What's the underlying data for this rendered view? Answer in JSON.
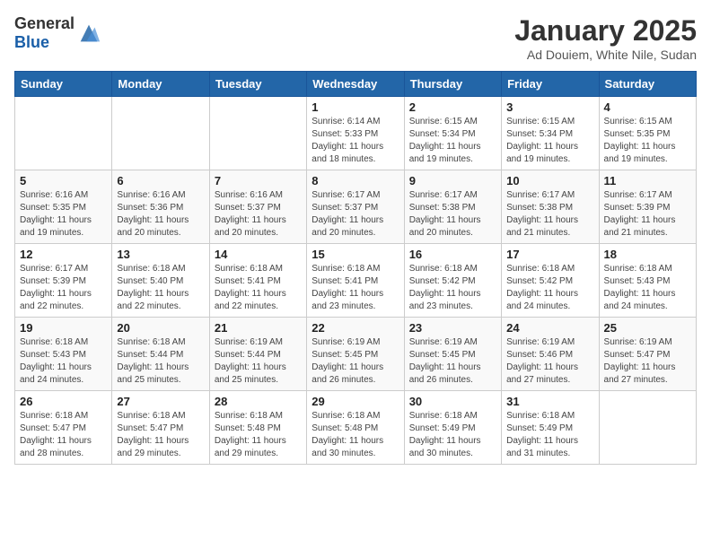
{
  "header": {
    "logo_general": "General",
    "logo_blue": "Blue",
    "month": "January 2025",
    "location": "Ad Douiem, White Nile, Sudan"
  },
  "weekdays": [
    "Sunday",
    "Monday",
    "Tuesday",
    "Wednesday",
    "Thursday",
    "Friday",
    "Saturday"
  ],
  "weeks": [
    [
      {
        "day": "",
        "sunrise": "",
        "sunset": "",
        "daylight": ""
      },
      {
        "day": "",
        "sunrise": "",
        "sunset": "",
        "daylight": ""
      },
      {
        "day": "",
        "sunrise": "",
        "sunset": "",
        "daylight": ""
      },
      {
        "day": "1",
        "sunrise": "6:14 AM",
        "sunset": "5:33 PM",
        "daylight": "11 hours and 18 minutes."
      },
      {
        "day": "2",
        "sunrise": "6:15 AM",
        "sunset": "5:34 PM",
        "daylight": "11 hours and 19 minutes."
      },
      {
        "day": "3",
        "sunrise": "6:15 AM",
        "sunset": "5:34 PM",
        "daylight": "11 hours and 19 minutes."
      },
      {
        "day": "4",
        "sunrise": "6:15 AM",
        "sunset": "5:35 PM",
        "daylight": "11 hours and 19 minutes."
      }
    ],
    [
      {
        "day": "5",
        "sunrise": "6:16 AM",
        "sunset": "5:35 PM",
        "daylight": "11 hours and 19 minutes."
      },
      {
        "day": "6",
        "sunrise": "6:16 AM",
        "sunset": "5:36 PM",
        "daylight": "11 hours and 20 minutes."
      },
      {
        "day": "7",
        "sunrise": "6:16 AM",
        "sunset": "5:37 PM",
        "daylight": "11 hours and 20 minutes."
      },
      {
        "day": "8",
        "sunrise": "6:17 AM",
        "sunset": "5:37 PM",
        "daylight": "11 hours and 20 minutes."
      },
      {
        "day": "9",
        "sunrise": "6:17 AM",
        "sunset": "5:38 PM",
        "daylight": "11 hours and 20 minutes."
      },
      {
        "day": "10",
        "sunrise": "6:17 AM",
        "sunset": "5:38 PM",
        "daylight": "11 hours and 21 minutes."
      },
      {
        "day": "11",
        "sunrise": "6:17 AM",
        "sunset": "5:39 PM",
        "daylight": "11 hours and 21 minutes."
      }
    ],
    [
      {
        "day": "12",
        "sunrise": "6:17 AM",
        "sunset": "5:39 PM",
        "daylight": "11 hours and 22 minutes."
      },
      {
        "day": "13",
        "sunrise": "6:18 AM",
        "sunset": "5:40 PM",
        "daylight": "11 hours and 22 minutes."
      },
      {
        "day": "14",
        "sunrise": "6:18 AM",
        "sunset": "5:41 PM",
        "daylight": "11 hours and 22 minutes."
      },
      {
        "day": "15",
        "sunrise": "6:18 AM",
        "sunset": "5:41 PM",
        "daylight": "11 hours and 23 minutes."
      },
      {
        "day": "16",
        "sunrise": "6:18 AM",
        "sunset": "5:42 PM",
        "daylight": "11 hours and 23 minutes."
      },
      {
        "day": "17",
        "sunrise": "6:18 AM",
        "sunset": "5:42 PM",
        "daylight": "11 hours and 24 minutes."
      },
      {
        "day": "18",
        "sunrise": "6:18 AM",
        "sunset": "5:43 PM",
        "daylight": "11 hours and 24 minutes."
      }
    ],
    [
      {
        "day": "19",
        "sunrise": "6:18 AM",
        "sunset": "5:43 PM",
        "daylight": "11 hours and 24 minutes."
      },
      {
        "day": "20",
        "sunrise": "6:18 AM",
        "sunset": "5:44 PM",
        "daylight": "11 hours and 25 minutes."
      },
      {
        "day": "21",
        "sunrise": "6:19 AM",
        "sunset": "5:44 PM",
        "daylight": "11 hours and 25 minutes."
      },
      {
        "day": "22",
        "sunrise": "6:19 AM",
        "sunset": "5:45 PM",
        "daylight": "11 hours and 26 minutes."
      },
      {
        "day": "23",
        "sunrise": "6:19 AM",
        "sunset": "5:45 PM",
        "daylight": "11 hours and 26 minutes."
      },
      {
        "day": "24",
        "sunrise": "6:19 AM",
        "sunset": "5:46 PM",
        "daylight": "11 hours and 27 minutes."
      },
      {
        "day": "25",
        "sunrise": "6:19 AM",
        "sunset": "5:47 PM",
        "daylight": "11 hours and 27 minutes."
      }
    ],
    [
      {
        "day": "26",
        "sunrise": "6:18 AM",
        "sunset": "5:47 PM",
        "daylight": "11 hours and 28 minutes."
      },
      {
        "day": "27",
        "sunrise": "6:18 AM",
        "sunset": "5:47 PM",
        "daylight": "11 hours and 29 minutes."
      },
      {
        "day": "28",
        "sunrise": "6:18 AM",
        "sunset": "5:48 PM",
        "daylight": "11 hours and 29 minutes."
      },
      {
        "day": "29",
        "sunrise": "6:18 AM",
        "sunset": "5:48 PM",
        "daylight": "11 hours and 30 minutes."
      },
      {
        "day": "30",
        "sunrise": "6:18 AM",
        "sunset": "5:49 PM",
        "daylight": "11 hours and 30 minutes."
      },
      {
        "day": "31",
        "sunrise": "6:18 AM",
        "sunset": "5:49 PM",
        "daylight": "11 hours and 31 minutes."
      },
      {
        "day": "",
        "sunrise": "",
        "sunset": "",
        "daylight": ""
      }
    ]
  ],
  "labels": {
    "sunrise_prefix": "Sunrise: ",
    "sunset_prefix": "Sunset: ",
    "daylight_prefix": "Daylight: "
  }
}
